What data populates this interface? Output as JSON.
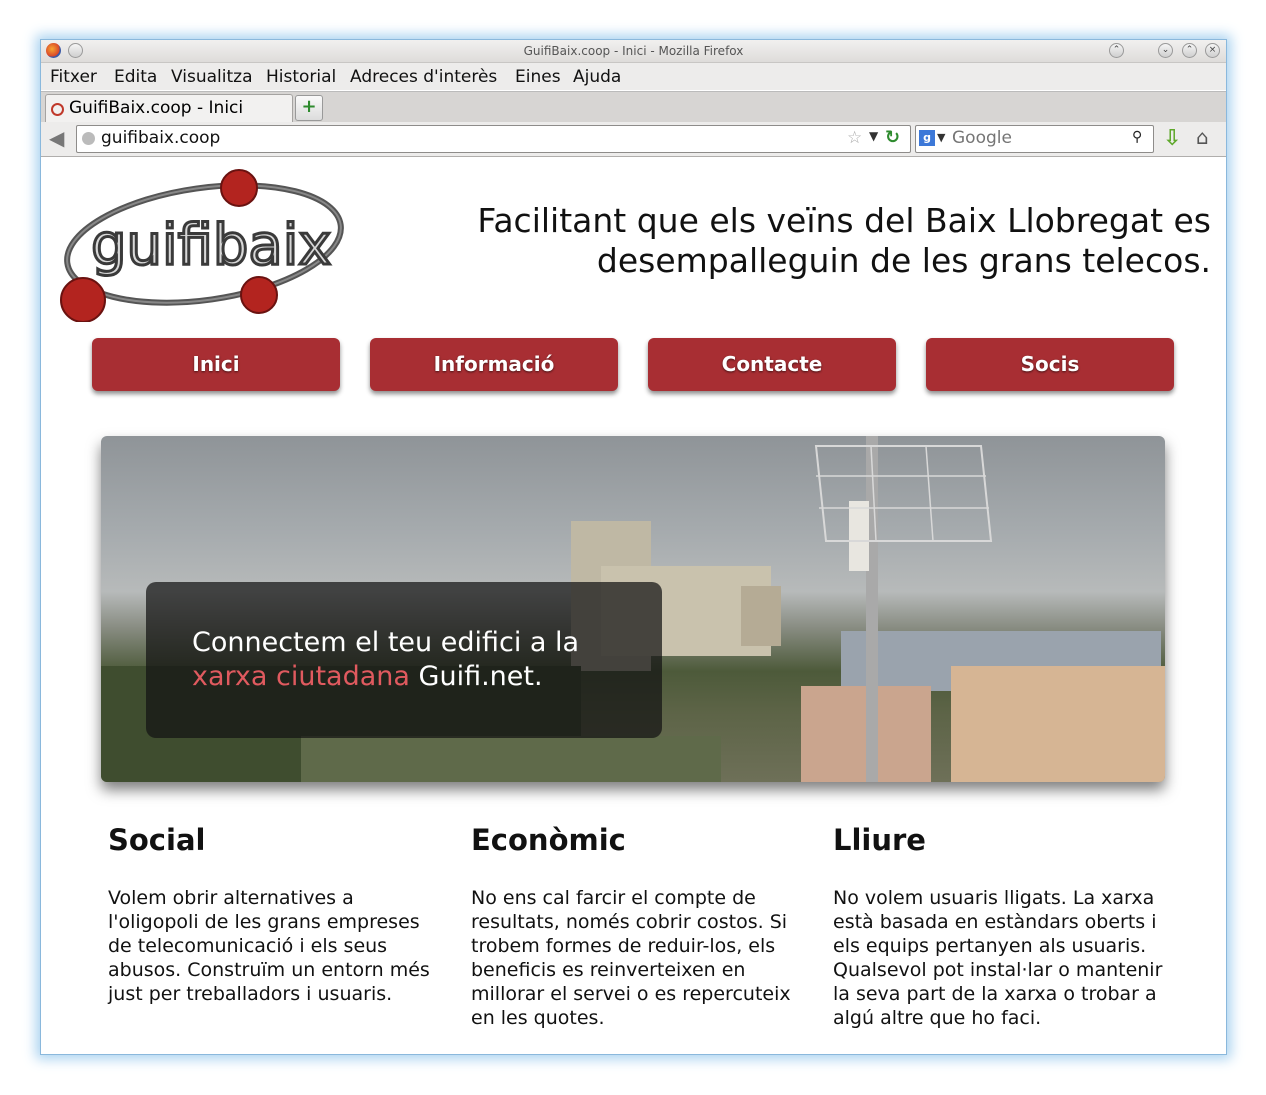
{
  "window": {
    "title": "GuifiBaix.coop - Inici - Mozilla Firefox"
  },
  "menu": [
    "Fitxer",
    "Edita",
    "Visualitza",
    "Historial",
    "Adreces d'interès",
    "Eines",
    "Ajuda"
  ],
  "tab": {
    "label": "GuifiBaix.coop - Inici",
    "new_tab": "+"
  },
  "navbar": {
    "url": "guifibaix.coop",
    "search_placeholder": "Google",
    "search_engine": "g"
  },
  "site": {
    "logo_text": "guifibaix",
    "tagline_line1": "Facilitant que els veïns del Baix Llobregat es",
    "tagline_line2": "desempalleguin de les grans telecos.",
    "nav": [
      "Inici",
      "Informació",
      "Contacte",
      "Socis"
    ],
    "accent_color": "#a82e33",
    "hero": {
      "text_before": "Connectem el teu edifici a la",
      "highlight": "xarxa ciutadana",
      "text_after": " Guifi.net."
    },
    "columns": [
      {
        "title": "Social",
        "text": "Volem obrir alternatives a l'oligopoli de les grans empreses de telecomunicació i els seus abusos. Construïm un entorn més just per treballadors i usuaris."
      },
      {
        "title": "Econòmic",
        "text": "No ens cal farcir el compte de resultats, només cobrir costos. Si trobem formes de reduir-los, els beneficis es reinverteixen en millorar el servei o es repercuteix en les quotes."
      },
      {
        "title": "Lliure",
        "text": "No volem usuaris lligats. La xarxa està basada en estàndars oberts i els equips pertanyen als usuaris. Qualsevol pot instal·lar o mantenir la seva part de la xarxa o trobar a algú altre que ho faci."
      }
    ]
  }
}
